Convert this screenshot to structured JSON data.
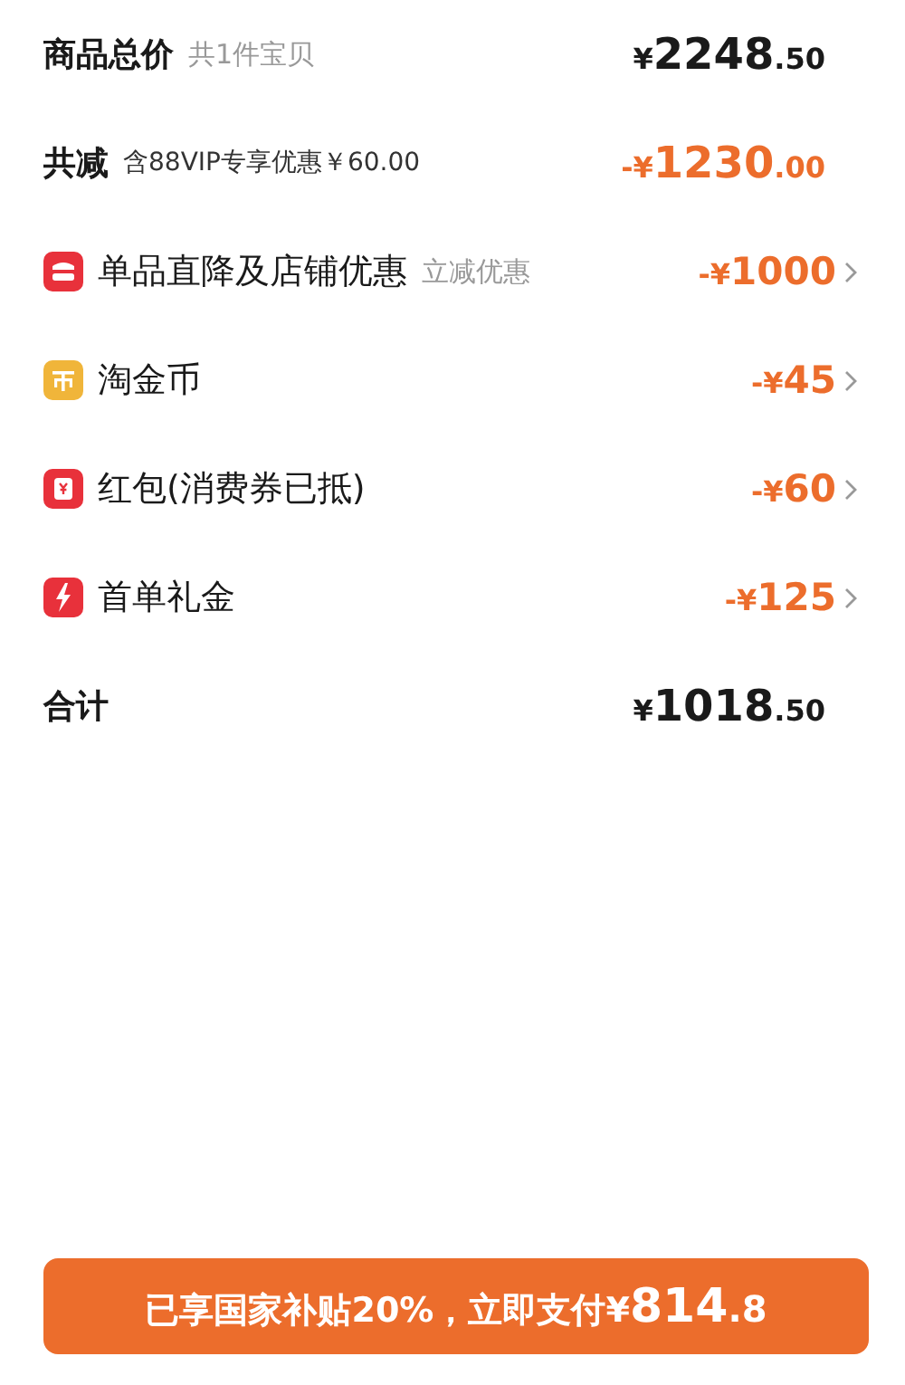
{
  "summary": {
    "label": "商品总价",
    "note": "共1件宝贝",
    "amount": {
      "currency": "¥",
      "integer": "2248",
      "decimal": ".50"
    }
  },
  "discount_total": {
    "label": "共减",
    "note": "含88VIP专享优惠￥60.00",
    "amount": {
      "sign": "-",
      "currency": "¥",
      "integer": "1230",
      "decimal": ".00"
    }
  },
  "discounts": [
    {
      "kind": "store",
      "label": "单品直降及店铺优惠",
      "note": "立减优惠",
      "amount": {
        "sign": "-",
        "currency": "¥",
        "integer": "1000"
      }
    },
    {
      "kind": "coin",
      "label": "淘金币",
      "amount": {
        "sign": "-",
        "currency": "¥",
        "integer": "45"
      }
    },
    {
      "kind": "envelope",
      "label": "红包(消费券已抵)",
      "amount": {
        "sign": "-",
        "currency": "¥",
        "integer": "60"
      }
    },
    {
      "kind": "bolt",
      "label": "首单礼金",
      "amount": {
        "sign": "-",
        "currency": "¥",
        "integer": "125"
      }
    }
  ],
  "total": {
    "label": "合计",
    "amount": {
      "currency": "¥",
      "integer": "1018",
      "decimal": ".50"
    }
  },
  "pay_button": {
    "label": "已享国家补贴20%，立即支付",
    "amount": {
      "currency": "¥",
      "integer": "814",
      "decimal": ".8"
    }
  }
}
